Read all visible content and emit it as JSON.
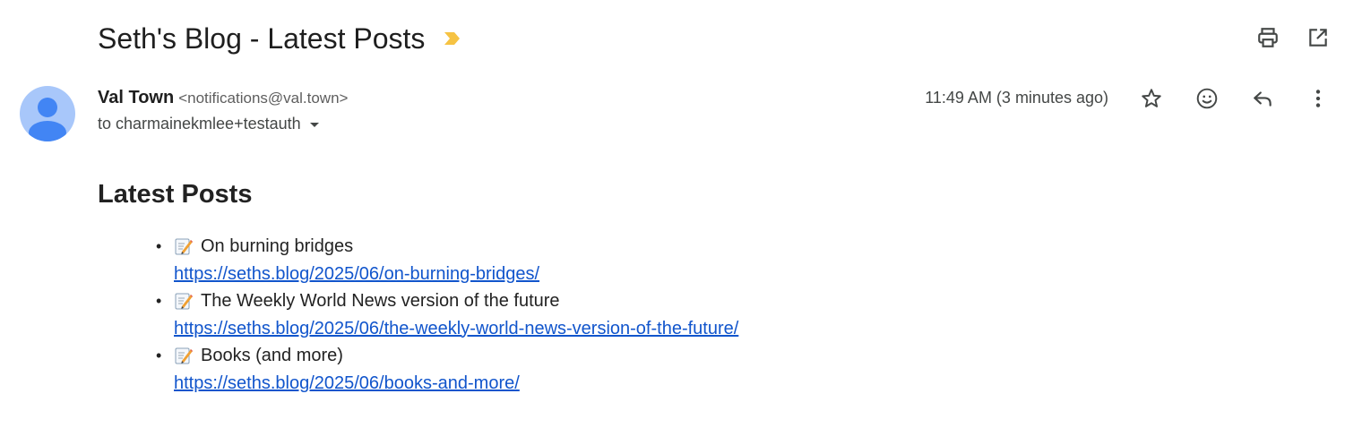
{
  "email": {
    "subject": "Seth's Blog - Latest Posts",
    "sender": {
      "name": "Val Town",
      "email": "<notifications@val.town>"
    },
    "recipient": "to charmainekmlee+testauth",
    "timestamp": "11:49 AM (3 minutes ago)"
  },
  "icons": {
    "importance": "importance-marker-icon",
    "print": "print-icon",
    "open_new_window": "open-in-new-window-icon",
    "star": "star-icon",
    "emoji": "emoji-reaction-icon",
    "reply": "reply-icon",
    "more": "more-options-icon",
    "recipient_details": "chevron-down-icon",
    "post": "memo-icon"
  },
  "body": {
    "heading": "Latest Posts",
    "bullet": "•",
    "posts": [
      {
        "title": "On burning bridges",
        "url": "https://seths.blog/2025/06/on-burning-bridges/"
      },
      {
        "title": "The Weekly World News version of the future",
        "url": "https://seths.blog/2025/06/the-weekly-world-news-version-of-the-future/"
      },
      {
        "title": "Books (and more)",
        "url": "https://seths.blog/2025/06/books-and-more/"
      }
    ]
  },
  "colors": {
    "importance_marker": "#f6c343",
    "avatar_background": "#a8c7fa",
    "avatar_figure": "#4285f4",
    "link": "#1155cc",
    "icon": "#444746"
  }
}
